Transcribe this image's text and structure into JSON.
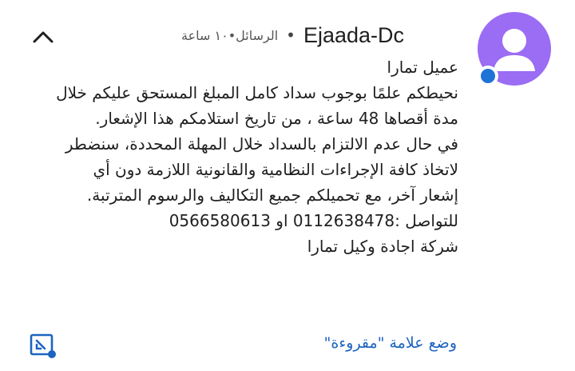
{
  "notification": {
    "sender": "Ejaada-Dc",
    "app_name": "الرسائل",
    "time": "١٠ ساعة",
    "avatar_color": "#9b6cf4",
    "badge_icon": "chat-bubble-icon",
    "collapse_icon": "chevron-up-icon",
    "message_lines": [
      "عميل تمارا",
      "نحيطكم علمًا بوجوب سداد كامل المبلغ المستحق عليكم خلال",
      "مدة أقصاها 48 ساعة ، من تاريخ استلامكم هذا الإشعار.",
      "في حال عدم الالتزام بالسداد خلال المهلة المحددة، سنضطر",
      "لاتخاذ كافة الإجراءات النظامية والقانونية اللازمة دون أي",
      "إشعار آخر، مع تحميلكم جميع التكاليف والرسوم المترتبة.",
      "للتواصل :0112638478 او 0566580613",
      "شركة اجادة وكيل تمارا"
    ],
    "actions": {
      "mark_read_label": "وضع علامة \"مقروءة\"",
      "mark_read_color": "#1d64c0",
      "open_icon": "open-in-app-icon"
    }
  }
}
